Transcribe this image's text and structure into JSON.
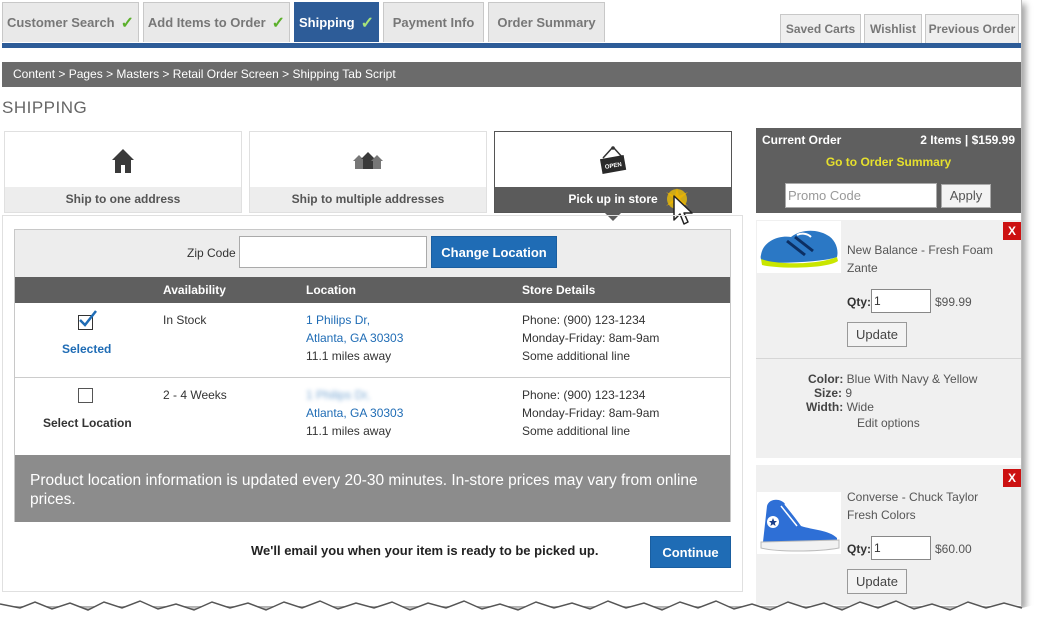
{
  "tabs": [
    {
      "label": "Customer Search",
      "done": true
    },
    {
      "label": "Add Items to Order",
      "done": true
    },
    {
      "label": "Shipping",
      "done": true,
      "active": true
    },
    {
      "label": "Payment Info",
      "done": false
    },
    {
      "label": "Order Summary",
      "done": false
    }
  ],
  "right_tabs": [
    "Saved Carts",
    "Wishlist",
    "Previous Order"
  ],
  "breadcrumb": "Content > Pages > Masters > Retail Order Screen > Shipping Tab Script",
  "page_title": "SHIPPING",
  "ship_options": [
    {
      "label": "Ship to one address",
      "icon": "house-icon"
    },
    {
      "label": "Ship to multiple addresses",
      "icon": "houses-icon"
    },
    {
      "label": "Pick up in store",
      "icon": "open-sign-icon",
      "active": true
    }
  ],
  "finder": {
    "zip_label": "Zip Code",
    "zip_value": "",
    "change_button": "Change Location",
    "columns": [
      "Availability",
      "Location",
      "Store Details"
    ],
    "rows": [
      {
        "checked": true,
        "select_label": "Selected",
        "availability": "In Stock",
        "address1": "1 Philips Dr,",
        "address2": "Atlanta, GA 30303",
        "distance": "11.1 miles away",
        "phone": "Phone: (900) 123-1234",
        "hours": "Monday-Friday: 8am-9am",
        "extra": "Some additional line"
      },
      {
        "checked": false,
        "select_label": "Select Location",
        "availability": "2 - 4 Weeks",
        "address1": "1 Philips Dr,",
        "address2": "Atlanta, GA 30303",
        "distance": "11.1 miles away",
        "phone": "Phone: (900) 123-1234",
        "hours": "Monday-Friday: 8am-9am",
        "extra": "Some additional line"
      }
    ],
    "notice": "Product location information is updated every 20-30 minutes. In-store prices may vary from online prices."
  },
  "email_message": "We'll email you when your item is ready to be picked up.",
  "continue_button": "Continue",
  "order": {
    "title": "Current Order",
    "count": "2 Items | $159.99",
    "summary_link": "Go to Order Summary",
    "promo_placeholder": "Promo Code",
    "apply_label": "Apply",
    "items": [
      {
        "name_line1": "New Balance - Fresh Foam",
        "name_line2": "Zante",
        "qty_label": "Qty:",
        "qty": "1",
        "price": "$99.99",
        "update_label": "Update",
        "remove_label": "X",
        "color_label": "Color:",
        "color": "Blue With Navy & Yellow",
        "size_label": "Size:",
        "size": "9",
        "width_label": "Width:",
        "width": "Wide",
        "edit_label": "Edit options"
      },
      {
        "name_line1": "Converse - Chuck Taylor",
        "name_line2": "Fresh Colors",
        "qty_label": "Qty:",
        "qty": "1",
        "price": "$60.00",
        "update_label": "Update",
        "remove_label": "X"
      }
    ]
  },
  "colors": {
    "accent": "#2d5c98",
    "button": "#1f6cb5",
    "remove": "#cc1111",
    "promo_link": "#e6e02d",
    "check": "#5bb02b"
  }
}
